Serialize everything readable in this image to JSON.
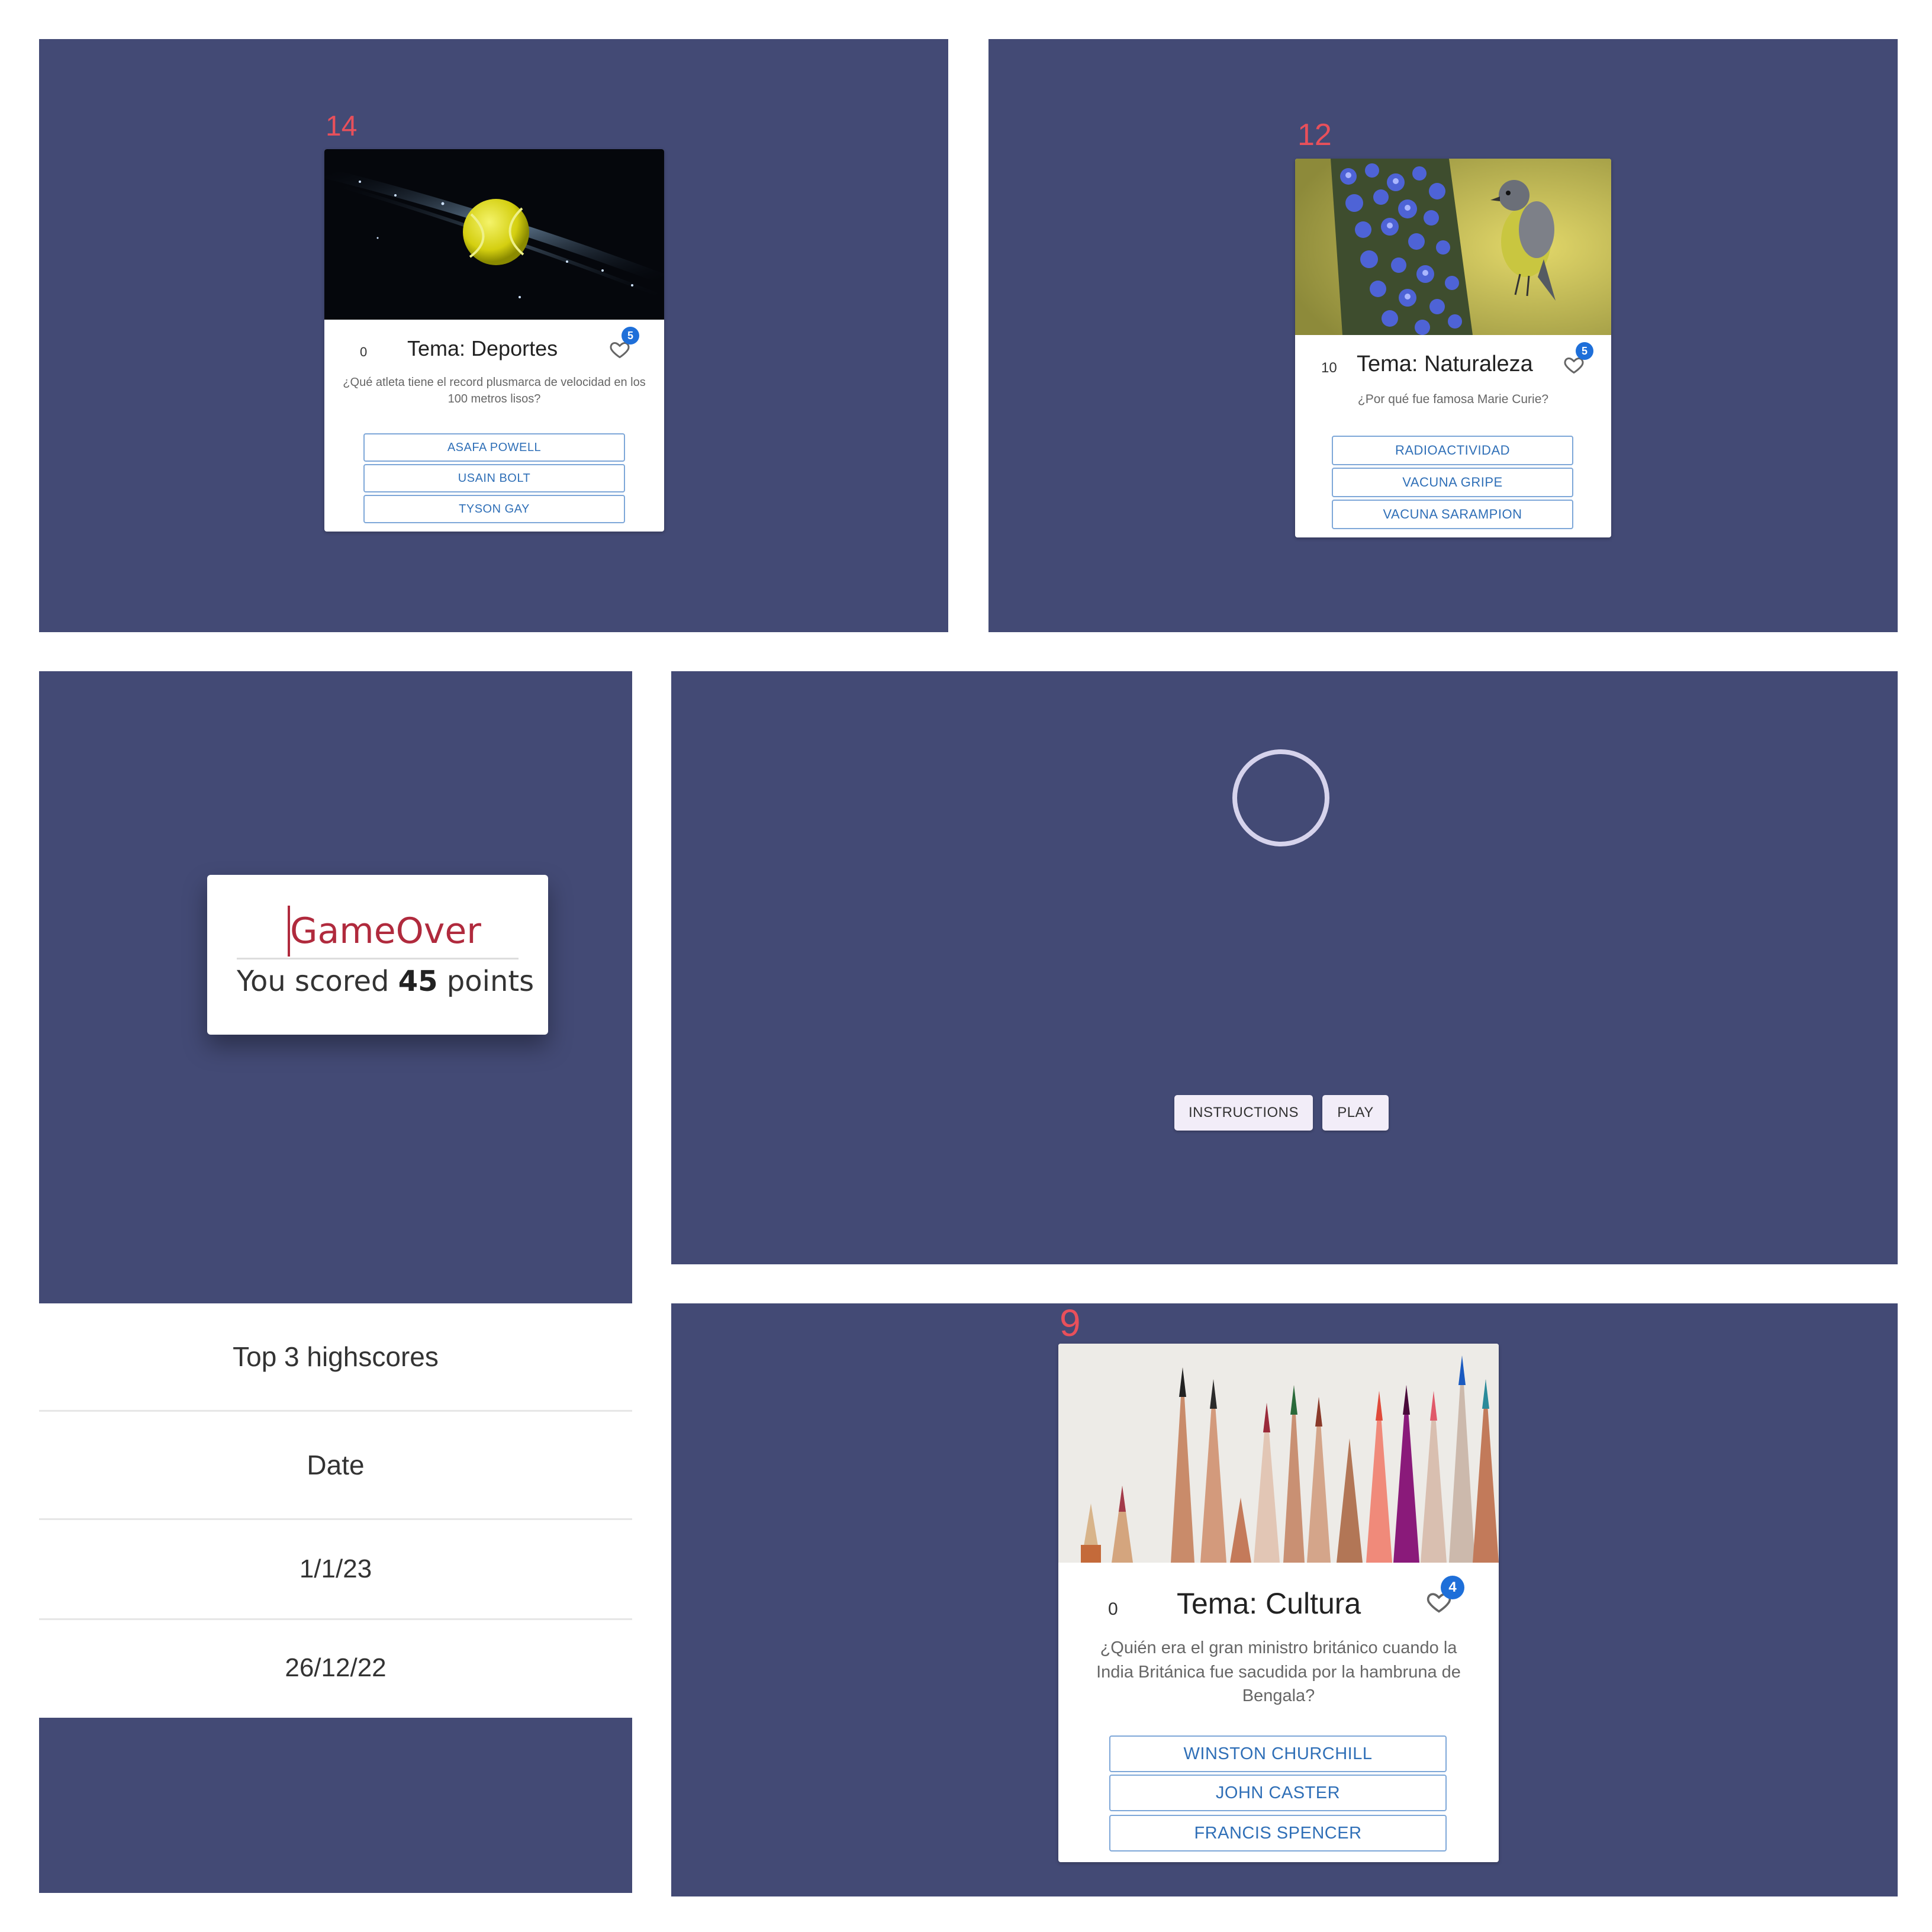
{
  "colors": {
    "panel_bg": "#434a75",
    "accent_red": "#e8505b",
    "answer_blue": "#2f6fb7",
    "badge_blue": "#1e6fd9",
    "gameover_red": "#b02a3d"
  },
  "panels": {
    "sports": {
      "timer": "14",
      "score": "0",
      "topic": "Tema: Deportes",
      "likes": "5",
      "question": "¿Qué atleta tiene el record plusmarca de velocidad en los 100 metros lisos?",
      "answers": [
        "ASAFA POWELL",
        "USAIN BOLT",
        "TYSON GAY"
      ],
      "image_icon": "tennis-ball-image"
    },
    "nature": {
      "timer": "12",
      "score": "10",
      "topic": "Tema: Naturaleza",
      "likes": "5",
      "question": "¿Por qué fue famosa Marie Curie?",
      "answers": [
        "RADIOACTIVIDAD",
        "VACUNA GRIPE",
        "VACUNA SARAMPION"
      ],
      "image_icon": "bird-flowers-image"
    },
    "gameover": {
      "title": "GameOver",
      "score_prefix": "You scored",
      "score_value": "45",
      "score_suffix": "points"
    },
    "highscores": {
      "title": "Top 3 highscores",
      "column": "Date",
      "rows": [
        "1/1/23",
        "26/12/22"
      ]
    },
    "menu": {
      "instructions_label": "INSTRUCTIONS",
      "play_label": "PLAY",
      "spinner_icon": "loading-spinner-icon"
    },
    "culture": {
      "timer": "9",
      "score": "0",
      "topic": "Tema: Cultura",
      "likes": "4",
      "question": "¿Quién era el gran ministro británico cuando la India Británica fue sacudida por la hambruna de Bengala?",
      "answers": [
        "WINSTON CHURCHILL",
        "JOHN CASTER",
        "FRANCIS SPENCER"
      ],
      "image_icon": "colored-pencils-image"
    }
  }
}
